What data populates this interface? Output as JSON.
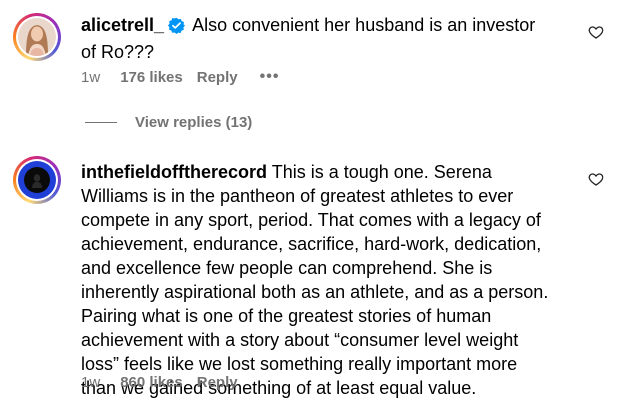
{
  "comments": [
    {
      "username": "alicetrell_",
      "verified": true,
      "text": "Also convenient her husband is an investor of Ro???",
      "time": "1w",
      "likes": "176 likes",
      "reply_label": "Reply",
      "more_label": "•••",
      "view_replies": "View replies (13)"
    },
    {
      "username": "inthefieldofftherecord",
      "verified": false,
      "text": "This is a tough one. Serena Williams is in the pantheon of greatest athletes to ever compete in any sport, period. That comes with a legacy of achievement, endurance, sacrifice, hard-work, dedication, and excellence few people can comprehend. She is inherently aspirational both as an athlete, and as a person. Pairing what is one of the greatest stories of human achievement with a story about “consumer level weight loss” feels like we lost something really important more than we gained something of at least equal value.",
      "time": "1w",
      "likes": "860 likes",
      "reply_label": "Reply"
    }
  ],
  "colors": {
    "verified": "#0095f6",
    "meta": "#737373",
    "avatar2_bg": "#1f3fd6"
  }
}
